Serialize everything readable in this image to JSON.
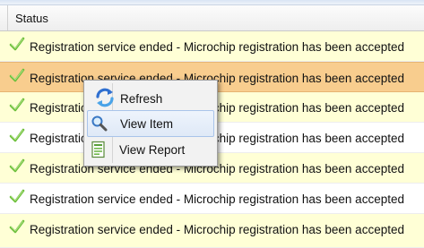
{
  "grid": {
    "column_header": "Status",
    "rows": [
      {
        "status": "Registration service ended - Microchip registration has been accepted",
        "style": "alt"
      },
      {
        "status": "Registration service ended - Microchip registration has been accepted",
        "style": "selected"
      },
      {
        "status": "Registration service ended - Microchip registration has been accepted",
        "style": "alt"
      },
      {
        "status": "Registration service ended - Microchip registration has been accepted",
        "style": "plain"
      },
      {
        "status": "Registration service ended - Microchip registration has been accepted",
        "style": "alt"
      },
      {
        "status": "Registration service ended - Microchip registration has been accepted",
        "style": "plain"
      },
      {
        "status": "Registration service ended - Microchip registration has been accepted",
        "style": "alt"
      }
    ]
  },
  "context_menu": {
    "items": [
      {
        "label": "Refresh",
        "icon": "refresh-icon"
      },
      {
        "label": "View Item",
        "icon": "magnifier-icon",
        "hovered": true
      },
      {
        "label": "View Report",
        "icon": "report-icon"
      }
    ]
  },
  "colors": {
    "row_alt": "#ffffd6",
    "row_selected": "#f8cd8e",
    "check": "#6cbf3a",
    "menu_hover_border": "#a9c4ea"
  }
}
